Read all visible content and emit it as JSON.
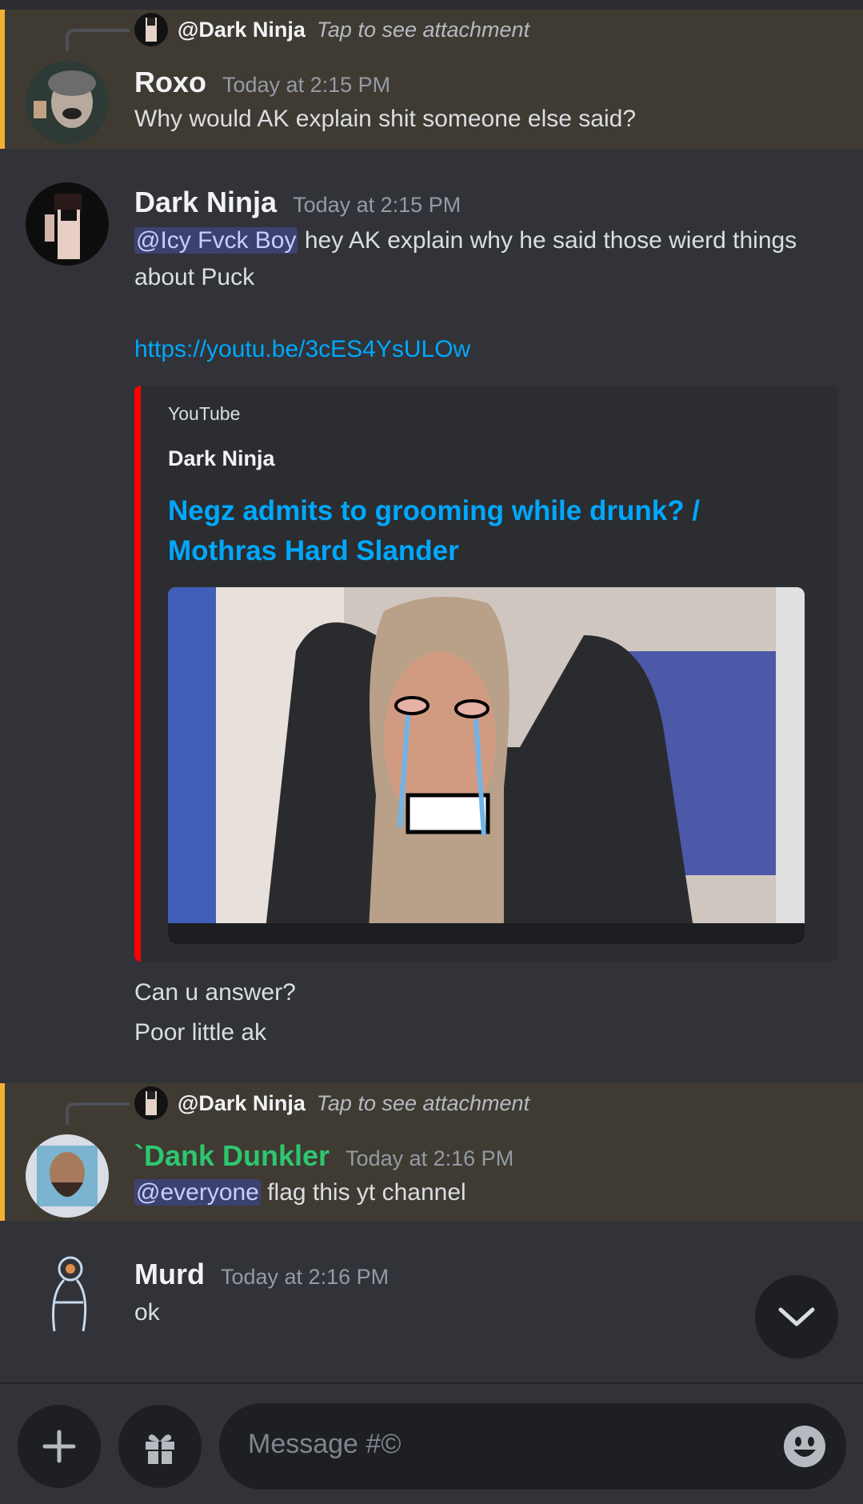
{
  "messages": [
    {
      "reply": {
        "name": "@Dark Ninja",
        "tap": "Tap to see attachment"
      },
      "author": "Roxo",
      "timestamp": "Today at 2:15 PM",
      "lines": [
        "Why would AK explain shit someone else said?"
      ]
    },
    {
      "author": "Dark Ninja",
      "timestamp": "Today at 2:15 PM",
      "mention": "@Icy Fvck Boy",
      "line1_rest": " hey AK explain why he said those wierd things",
      "line2": "about Puck",
      "link": "https://youtu.be/3cES4YsULOw",
      "embed": {
        "provider": "YouTube",
        "author": "Dark Ninja",
        "title": "Negz admits to grooming while drunk? / Mothras Hard Slander"
      },
      "after_lines": [
        "Can u answer?",
        "Poor little ak"
      ]
    },
    {
      "reply": {
        "name": "@Dark Ninja",
        "tap": "Tap to see attachment"
      },
      "author": "`Dank Dunkler",
      "author_color": "#2dc770",
      "timestamp": "Today at 2:16 PM",
      "mention": "@everyone",
      "rest": " flag this yt channel"
    },
    {
      "author": "Murd",
      "timestamp": "Today at 2:16 PM",
      "lines": [
        "ok"
      ]
    }
  ],
  "composer": {
    "placeholder": "Message #©"
  },
  "colors": {
    "background": "#313338",
    "mention_highlight": "#3f3b33",
    "mention_bar": "#f0b232",
    "link": "#00a8fc",
    "embed_bar": "#ff0000"
  }
}
